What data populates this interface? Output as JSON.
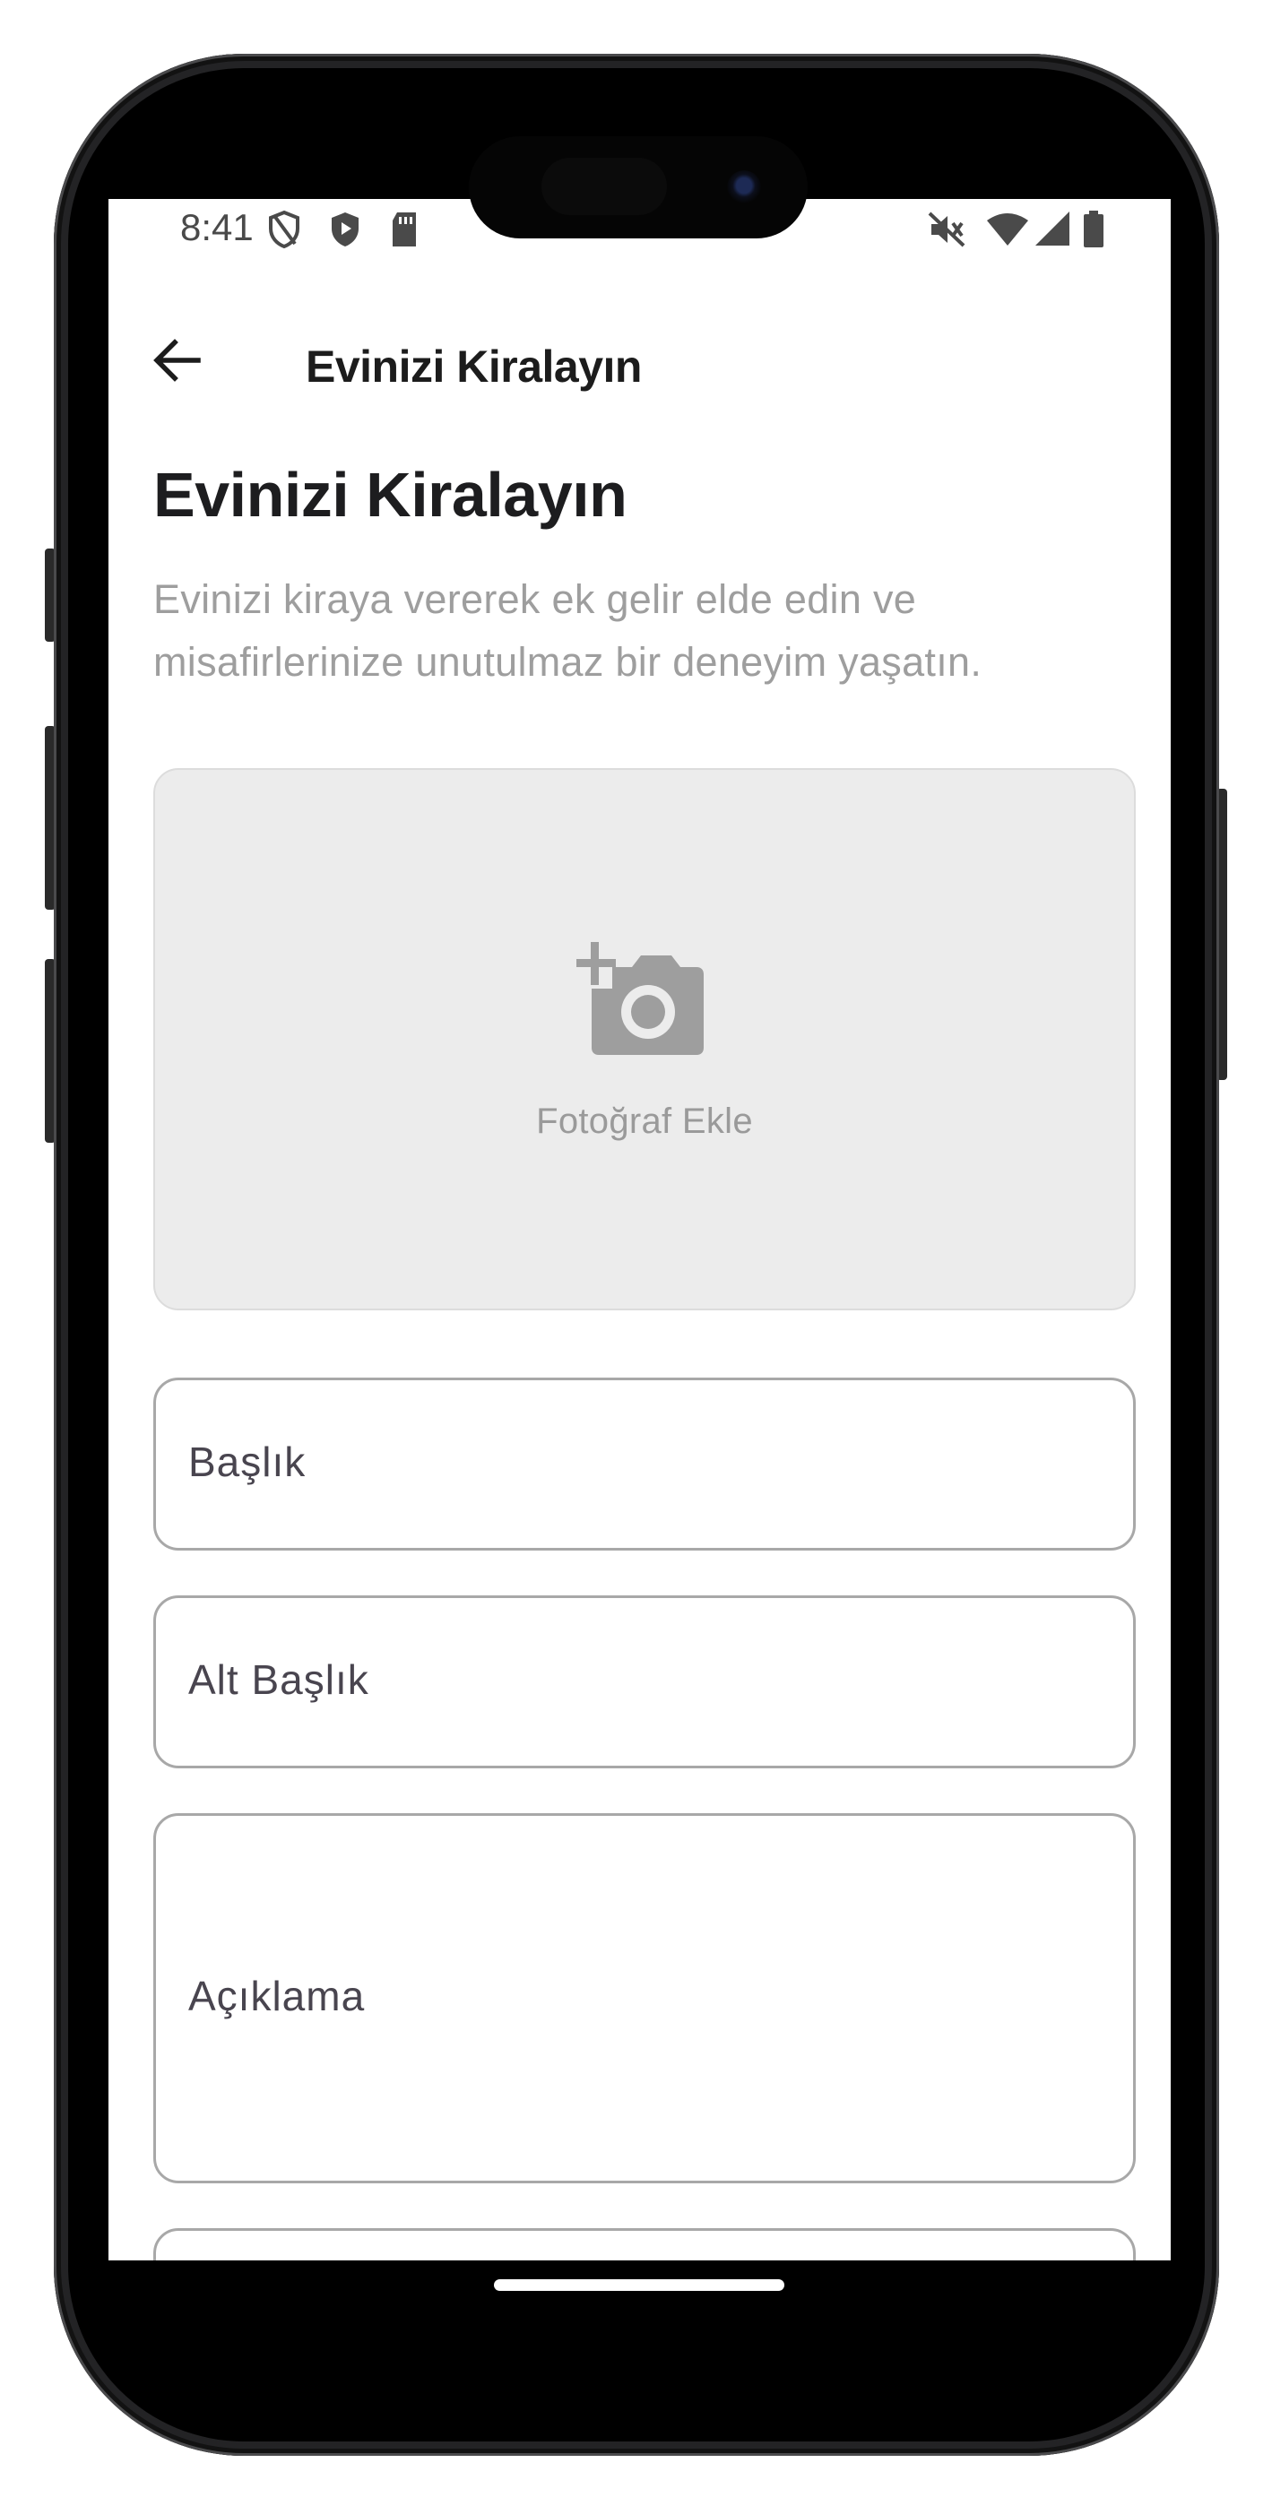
{
  "status_bar": {
    "time": "8:41",
    "left_icons": [
      "privacy-shield-icon",
      "play-protect-icon",
      "sd-card-icon"
    ],
    "right_icons": [
      "mute-icon",
      "wifi-icon",
      "cellular-signal-icon",
      "battery-icon"
    ]
  },
  "app_bar": {
    "back_icon": "arrow-left-icon",
    "title": "Evinizi Kiralayın"
  },
  "main": {
    "title": "Evinizi Kiralayın",
    "subtitle": "Evinizi kiraya vererek ek gelir elde edin ve misafirlerinize unutulmaz bir deneyim yaşatın.",
    "photo_upload": {
      "icon": "add-photo-camera-icon",
      "label": "Fotoğraf Ekle"
    },
    "fields": [
      {
        "label": "Başlık",
        "value": ""
      },
      {
        "label": "Alt Başlık",
        "value": ""
      },
      {
        "label": "Açıklama",
        "value": ""
      }
    ]
  },
  "colors": {
    "background": "#ffffff",
    "title_text": "#1d1d1f",
    "subtitle_text": "#9e9e9e",
    "photo_box_bg": "#ececec",
    "field_border": "#a8a8a8",
    "icon_gray": "#9e9e9e"
  }
}
